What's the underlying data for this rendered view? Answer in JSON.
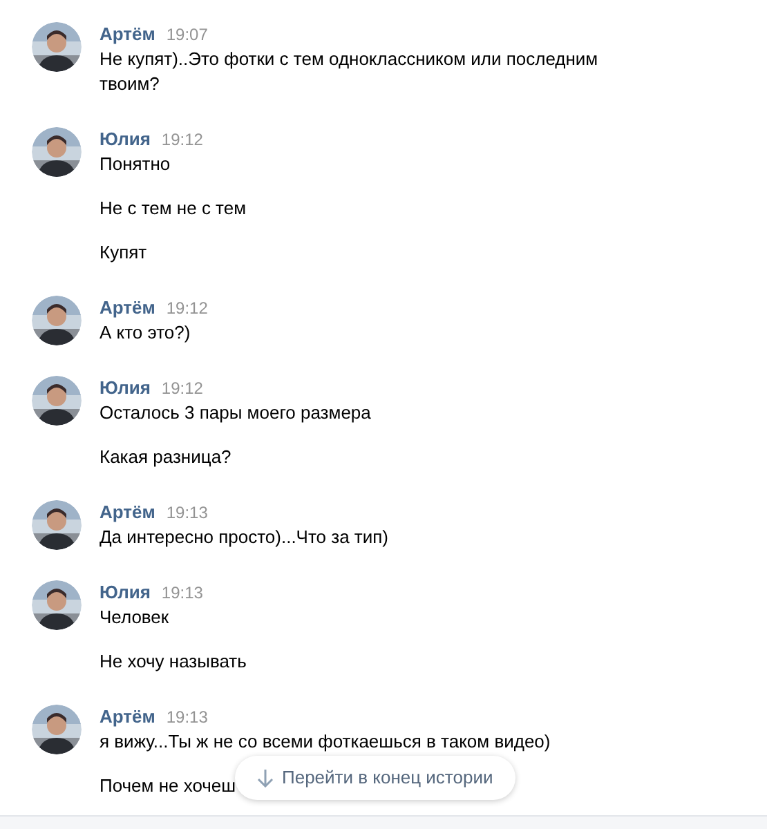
{
  "groups": [
    {
      "author": "Артём",
      "time": "19:07",
      "avatar": {
        "kind": "picture"
      },
      "messages": [
        "Не купят)..Это фотки с тем одноклассником или последним твоим?"
      ]
    },
    {
      "author": "Юлия",
      "time": "19:12",
      "avatar": {
        "kind": "picture"
      },
      "messages": [
        "Понятно",
        "Не с тем не с тем",
        "Купят"
      ]
    },
    {
      "author": "Артём",
      "time": "19:12",
      "avatar": {
        "kind": "picture"
      },
      "messages": [
        "А кто это?)"
      ]
    },
    {
      "author": "Юлия",
      "time": "19:12",
      "avatar": {
        "kind": "picture"
      },
      "messages": [
        "Осталось 3 пары моего размера",
        "Какая разница?"
      ]
    },
    {
      "author": "Артём",
      "time": "19:13",
      "avatar": {
        "kind": "picture"
      },
      "messages": [
        "Да интересно просто)...Что за тип)"
      ]
    },
    {
      "author": "Юлия",
      "time": "19:13",
      "avatar": {
        "kind": "picture"
      },
      "messages": [
        "Человек",
        "Не хочу называть"
      ]
    },
    {
      "author": "Артём",
      "time": "19:13",
      "avatar": {
        "kind": "picture"
      },
      "messages": [
        "я вижу...Ты ж не со всеми фоткаешься в таком видео)",
        "Почем не хочеш"
      ]
    }
  ],
  "scroll_button": {
    "label": "Перейти в конец истории"
  }
}
